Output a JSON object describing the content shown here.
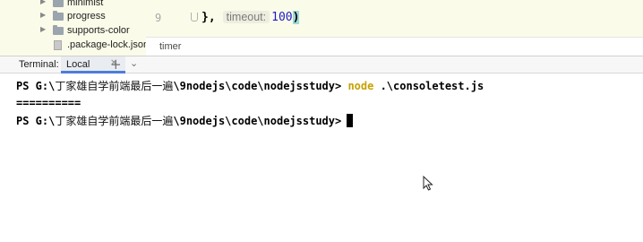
{
  "project_tree": {
    "items": [
      {
        "label": "minimist",
        "kind": "folder"
      },
      {
        "label": "progress",
        "kind": "folder"
      },
      {
        "label": "supports-color",
        "kind": "folder"
      },
      {
        "label": ".package-lock.json",
        "kind": "file"
      }
    ]
  },
  "editor": {
    "line_number": "9",
    "code": {
      "brace": "},",
      "hint": "timeout:",
      "value": "100",
      "paren": ")"
    },
    "breadcrumb": "timer"
  },
  "terminal": {
    "title": "Terminal:",
    "tab_label": "Local",
    "lines": [
      {
        "prompt_prefix": "PS G:\\",
        "path_cjk": "丁家雄自学前端最后一遍",
        "path_rest": "\\9nodejs\\code\\nodejsstudy>",
        "command": "node",
        "args": " .\\consoletest.js"
      },
      {
        "output": "=========="
      },
      {
        "prompt_prefix": "PS G:\\",
        "path_cjk": "丁家雄自学前端最后一遍",
        "path_rest": "\\9nodejs\\code\\nodejsstudy>"
      }
    ]
  },
  "colors": {
    "editor_bg": "#fbfbe9",
    "command_color": "#c7a200",
    "number_color": "#1c1cc7",
    "tab_accent": "#4c7ed9"
  },
  "icons": {
    "tree_chevron": "chevron-right-icon",
    "folder": "folder-icon",
    "file": "json-file-icon",
    "add_tab": "plus-icon",
    "tab_options": "chevron-down-icon",
    "close": "close-icon"
  }
}
